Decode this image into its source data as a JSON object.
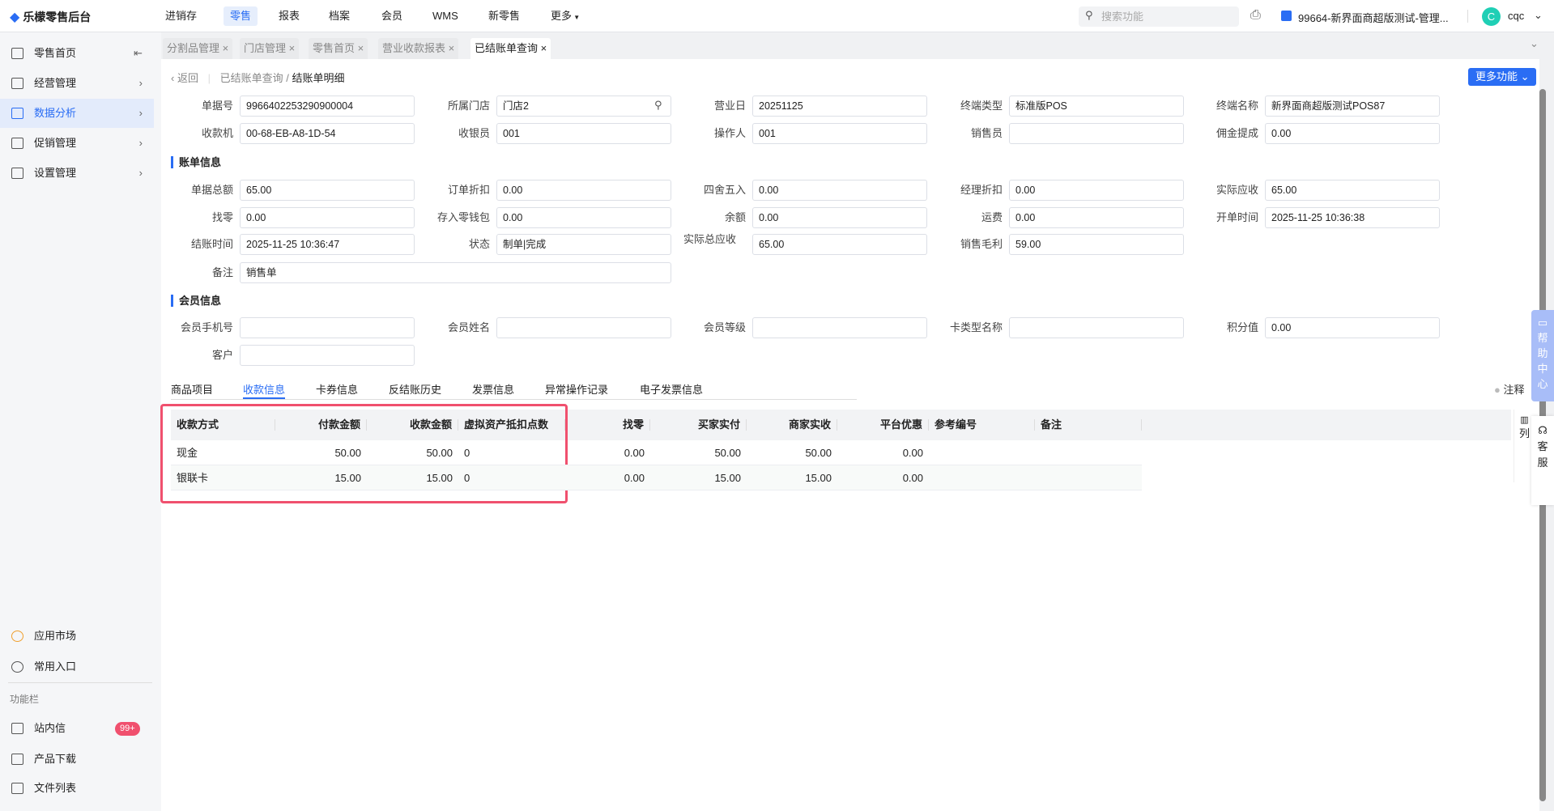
{
  "app": {
    "title": "乐檬零售后台"
  },
  "topnav": [
    "进销存",
    "零售",
    "报表",
    "档案",
    "会员",
    "WMS",
    "新零售",
    "更多"
  ],
  "search_placeholder": "搜索功能",
  "store": "99664-新界面商超版测试-管理...",
  "user": {
    "avatar": "C",
    "name": "cqc"
  },
  "sidebar": {
    "items": [
      "零售首页",
      "经营管理",
      "数据分析",
      "促销管理",
      "设置管理"
    ],
    "bottom": [
      "应用市场",
      "常用入口"
    ],
    "section": "功能栏",
    "tools": [
      "站内信",
      "产品下载",
      "文件列表"
    ],
    "badge": "99+"
  },
  "tabs": [
    "分割品管理",
    "门店管理",
    "零售首页",
    "营业收款报表",
    "已结账单查询"
  ],
  "breadcrumb": {
    "back": "返回",
    "parent": "已结账单查询",
    "current": "结账单明细"
  },
  "more_button": "更多功能",
  "form": {
    "row1": [
      [
        "单据号",
        "9966402253290900004"
      ],
      [
        "所属门店",
        "门店2"
      ],
      [
        "营业日",
        "20251125"
      ],
      [
        "终端类型",
        "标准版POS"
      ],
      [
        "终端名称",
        "新界面商超版测试POS87"
      ]
    ],
    "row2": [
      [
        "收款机",
        "00-68-EB-A8-1D-54"
      ],
      [
        "收银员",
        "001"
      ],
      [
        "操作人",
        "001"
      ],
      [
        "销售员",
        ""
      ],
      [
        "佣金提成",
        "0.00"
      ]
    ],
    "sec_bill": "账单信息",
    "row3": [
      [
        "单据总额",
        "65.00"
      ],
      [
        "订单折扣",
        "0.00"
      ],
      [
        "四舍五入",
        "0.00"
      ],
      [
        "经理折扣",
        "0.00"
      ],
      [
        "实际应收",
        "65.00"
      ]
    ],
    "row4": [
      [
        "找零",
        "0.00"
      ],
      [
        "存入零钱包",
        "0.00"
      ],
      [
        "余额",
        "0.00"
      ],
      [
        "运费",
        "0.00"
      ],
      [
        "开单时间",
        "2025-11-25 10:36:38"
      ]
    ],
    "row5": [
      [
        "结账时间",
        "2025-11-25 10:36:47"
      ],
      [
        "状态",
        "制单|完成"
      ],
      [
        "实际总应收",
        "65.00"
      ],
      [
        "销售毛利",
        "59.00"
      ]
    ],
    "remark": [
      "备注",
      "销售单"
    ],
    "sec_member": "会员信息",
    "row6": [
      [
        "会员手机号",
        ""
      ],
      [
        "会员姓名",
        ""
      ],
      [
        "会员等级",
        ""
      ],
      [
        "卡类型名称",
        ""
      ],
      [
        "积分值",
        "0.00"
      ]
    ],
    "customer": [
      "客户",
      ""
    ]
  },
  "detail_tabs": [
    "商品项目",
    "收款信息",
    "卡券信息",
    "反结账历史",
    "发票信息",
    "异常操作记录",
    "电子发票信息"
  ],
  "note_label": "注释",
  "columns_label": "列",
  "table": {
    "headers": [
      "收款方式",
      "付款金额",
      "收款金额",
      "虚拟资产抵扣点数",
      "找零",
      "买家实付",
      "商家实收",
      "平台优惠",
      "参考编号",
      "备注"
    ],
    "rows": [
      [
        "现金",
        "50.00",
        "50.00",
        "0",
        "0.00",
        "50.00",
        "50.00",
        "0.00",
        "",
        ""
      ],
      [
        "银联卡",
        "15.00",
        "15.00",
        "0",
        "0.00",
        "15.00",
        "15.00",
        "0.00",
        "",
        ""
      ]
    ]
  },
  "side_help": "帮助中心",
  "side_service": "客服",
  "colors": {
    "accent": "#2a6df4",
    "highlight": "#f0506e"
  }
}
